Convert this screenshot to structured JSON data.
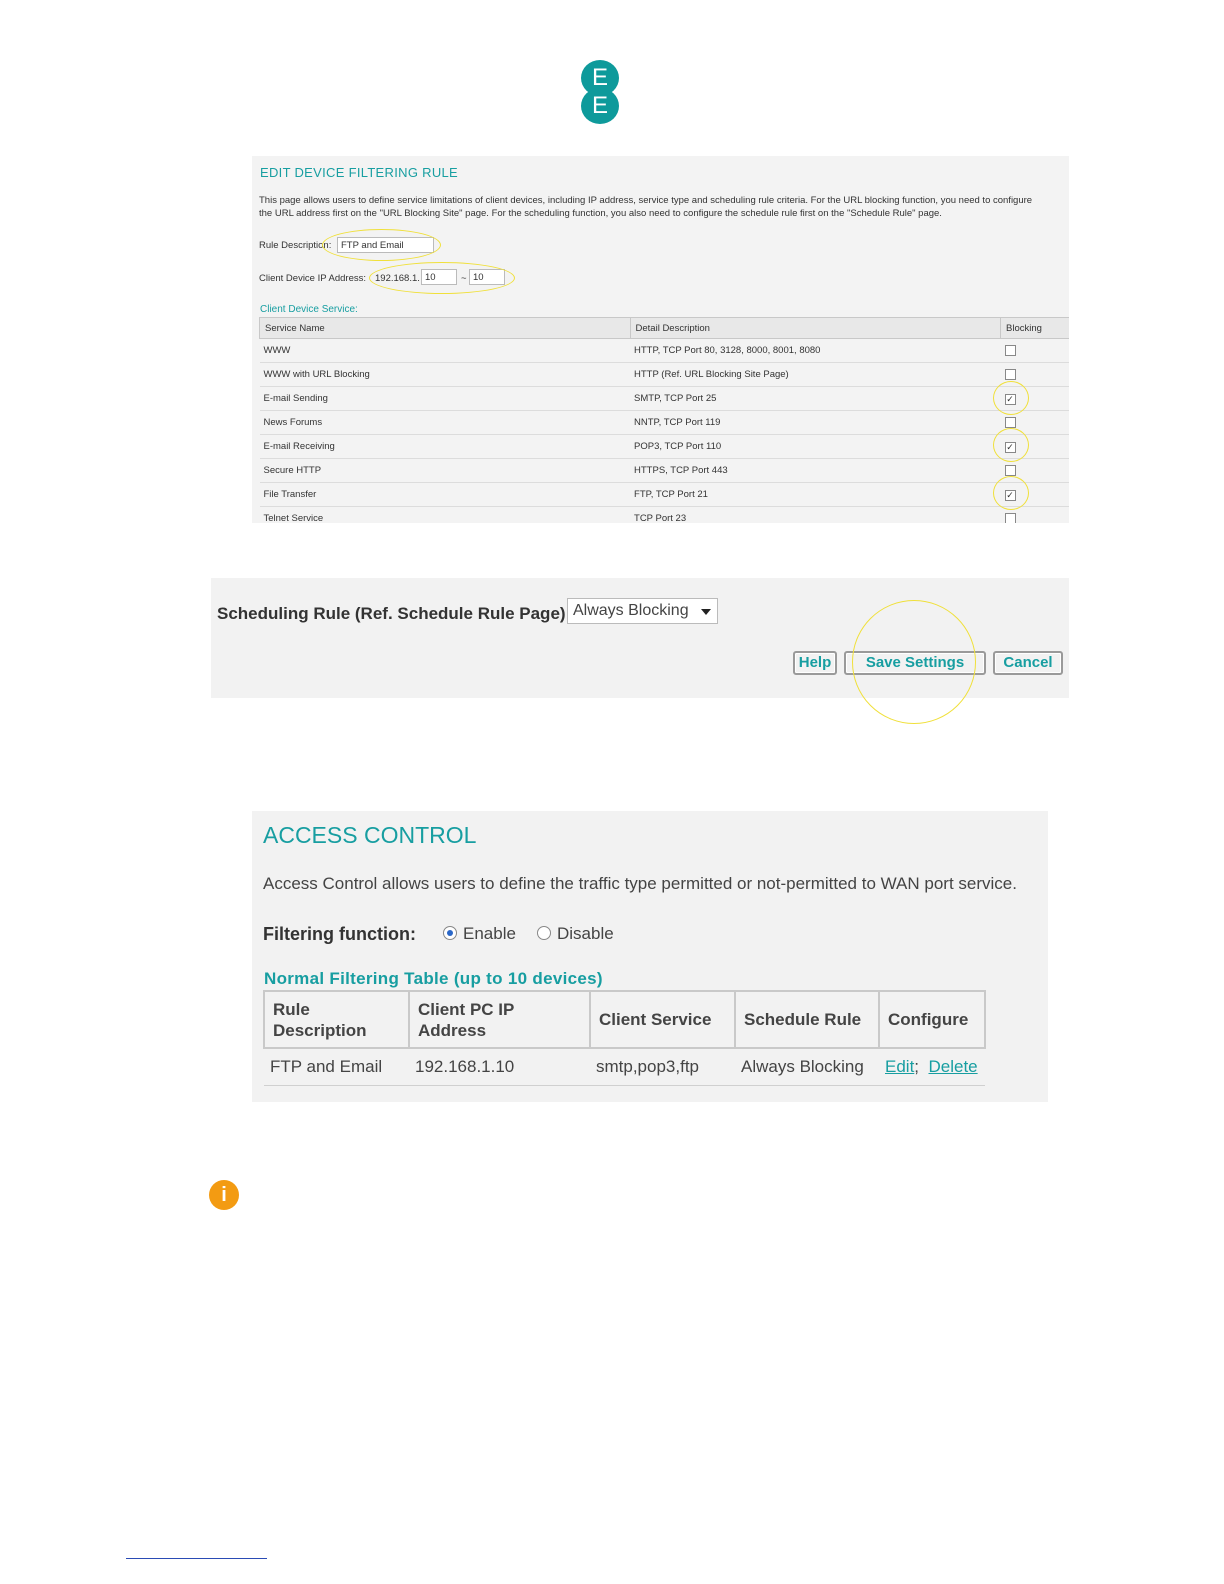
{
  "logo": {
    "letters": [
      "E",
      "E"
    ],
    "color": "#0e9a9b"
  },
  "edit_rule": {
    "title": "EDIT DEVICE FILTERING RULE",
    "intro_line1": "This page allows users to define service limitations of client devices, including IP address, service type and scheduling rule criteria. For the URL blocking function, you need to configure",
    "intro_line2": "the URL address first on the \"URL Blocking Site\" page. For the scheduling function, you also need to configure the schedule rule first on the \"Schedule Rule\" page.",
    "rule_description_label": "Rule Description:",
    "rule_description_value": "FTP and Email",
    "client_ip_label": "Client Device IP Address:",
    "ip_prefix": "192.168.1.",
    "ip_start": "10",
    "ip_separator": "~",
    "ip_end": "10",
    "service_section_title": "Client Device Service:",
    "columns": [
      "Service Name",
      "Detail Description",
      "Blocking"
    ],
    "services": [
      {
        "name": "WWW",
        "detail": "HTTP, TCP Port 80, 3128, 8000, 8001, 8080",
        "blocked": false
      },
      {
        "name": "WWW with URL Blocking",
        "detail": "HTTP (Ref. URL Blocking Site Page)",
        "blocked": false
      },
      {
        "name": "E-mail Sending",
        "detail": "SMTP, TCP Port 25",
        "blocked": true
      },
      {
        "name": "News Forums",
        "detail": "NNTP, TCP Port 119",
        "blocked": false
      },
      {
        "name": "E-mail Receiving",
        "detail": "POP3, TCP Port 110",
        "blocked": true
      },
      {
        "name": "Secure HTTP",
        "detail": "HTTPS, TCP Port 443",
        "blocked": false
      },
      {
        "name": "File Transfer",
        "detail": "FTP, TCP Port 21",
        "blocked": true
      },
      {
        "name": "Telnet Service",
        "detail": "TCP Port 23",
        "blocked": false
      }
    ]
  },
  "scheduling": {
    "label": "Scheduling Rule (Ref. Schedule Rule Page):",
    "selected": "Always Blocking",
    "help_button": "Help",
    "save_button": "Save Settings",
    "cancel_button": "Cancel"
  },
  "access_control": {
    "title": "ACCESS CONTROL",
    "description": "Access Control allows users to define the traffic type permitted or not-permitted to WAN port service.",
    "filtering_label": "Filtering function:",
    "enable_label": "Enable",
    "disable_label": "Disable",
    "enabled": true,
    "table_title": "Normal Filtering Table (up to 10 devices)",
    "columns": {
      "rule_line1": "Rule",
      "rule_line2": "Description",
      "ip_line1": "Client PC IP",
      "ip_line2": "Address",
      "service": "Client Service",
      "schedule": "Schedule Rule",
      "configure": "Configure"
    },
    "row": {
      "rule": "FTP and Email",
      "ip": "192.168.1.10",
      "service": "smtp,pop3,ftp",
      "schedule": "Always Blocking",
      "edit": "Edit",
      "sep": ";",
      "delete": "Delete"
    }
  },
  "info_icon": {
    "glyph": "i",
    "color": "#f39b12"
  },
  "colors": {
    "accent": "#179ea1",
    "highlight": "#f0e03a"
  }
}
